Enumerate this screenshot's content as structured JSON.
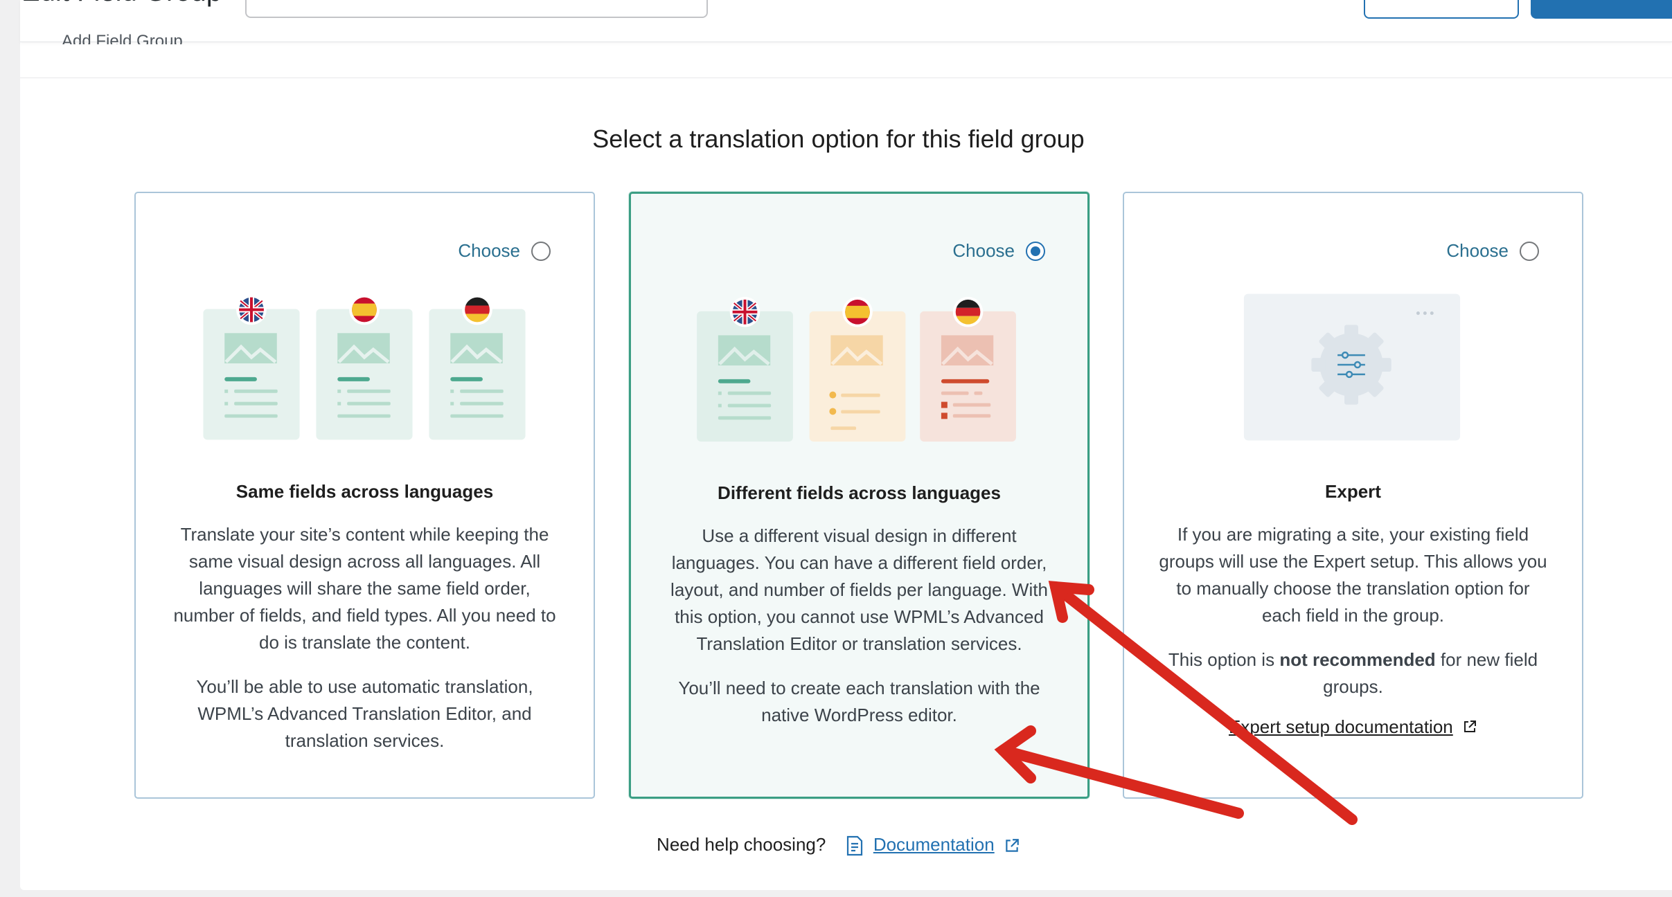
{
  "header": {
    "page_title": "Edit Field Group",
    "sub_crumb": "Add Field Group"
  },
  "heading": "Select a translation option for this field group",
  "cards": [
    {
      "choose_label": "Choose",
      "selected": false,
      "title": "Same fields across languages",
      "paragraphs": [
        "Translate your site’s content while keeping the same visual design across all languages. All languages will share the same field order, number of fields, and field types. All you need to do is translate the content.",
        "You’ll be able to use automatic translation, WPML’s Advanced Translation Editor, and translation services."
      ]
    },
    {
      "choose_label": "Choose",
      "selected": true,
      "title": "Different fields across languages",
      "paragraphs": [
        "Use a different visual design in different languages. You can have a different field order, layout, and number of fields per language. With this option, you cannot use WPML’s Advanced Translation Editor or translation services.",
        "You’ll need to create each translation with the native WordPress editor."
      ]
    },
    {
      "choose_label": "Choose",
      "selected": false,
      "title": "Expert",
      "paragraphs": [
        "If you are migrating a site, your existing field groups will use the Expert setup. This allows you to manually choose the translation option for each field in the group."
      ],
      "note_prefix": "This option is ",
      "note_bold": "not recommended",
      "note_suffix": " for new field groups.",
      "doc_link": "Expert setup documentation"
    }
  ],
  "footer": {
    "help_text": "Need help choosing?",
    "doc_link": "Documentation"
  },
  "colors": {
    "accent": "#2271b1",
    "selected_border": "#3b9e84",
    "arrow": "#d9281e"
  }
}
